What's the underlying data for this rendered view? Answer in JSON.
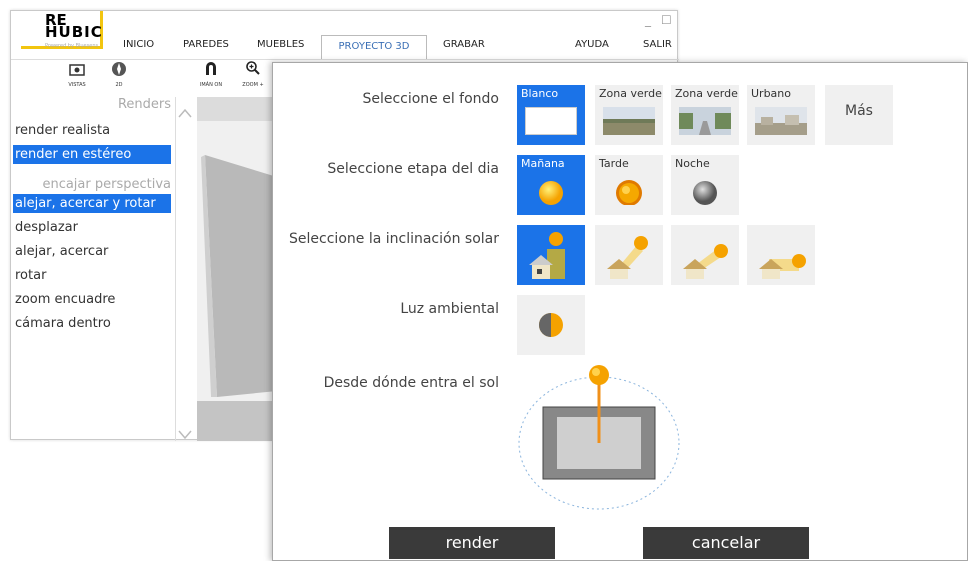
{
  "app": {
    "logo_line1": "RE",
    "logo_line2": "HUBIC",
    "logo_sub": "Powered by Bluesens",
    "menu": [
      "INICIO",
      "PAREDES",
      "MUEBLES",
      "PROYECTO 3D",
      "GRABAR",
      "AYUDA",
      "SALIR"
    ],
    "minimize": "_",
    "maximize": "☐",
    "toolbar": [
      {
        "label": "VISTAS",
        "icon": "camera-icon"
      },
      {
        "label": "2D",
        "icon": "compass-icon"
      },
      {
        "label": "IMÁN ON",
        "icon": "magnet-icon"
      },
      {
        "label": "ZOOM +",
        "icon": "zoom-in-icon"
      }
    ]
  },
  "sidebar": {
    "header": "Renders",
    "items": [
      "render realista",
      "render en estéreo"
    ],
    "subheader": "encajar perspectiva",
    "nav": [
      "alejar, acercar y rotar",
      "desplazar",
      "alejar, acercar",
      "rotar",
      "zoom encuadre",
      "cámara dentro"
    ]
  },
  "dialog": {
    "background": {
      "label": "Seleccione el fondo",
      "options": [
        "Blanco",
        "Zona verde",
        "Zona verde",
        "Urbano",
        "Más"
      ],
      "selected": "Blanco"
    },
    "daytime": {
      "label": "Seleccione etapa del dia",
      "options": [
        "Mañana",
        "Tarde",
        "Noche"
      ],
      "selected": "Mañana"
    },
    "inclination": {
      "label": "Seleccione la inclinación solar",
      "selected_index": 0
    },
    "ambient": {
      "label": "Luz ambiental"
    },
    "sun_direction": {
      "label": "Desde dónde entra el sol"
    },
    "buttons": {
      "render": "render",
      "cancel": "cancelar"
    }
  },
  "colors": {
    "accent": "#1b73e8",
    "sun": "#f5a200",
    "button": "#3a3a3a",
    "logo": "#f2c50f"
  }
}
